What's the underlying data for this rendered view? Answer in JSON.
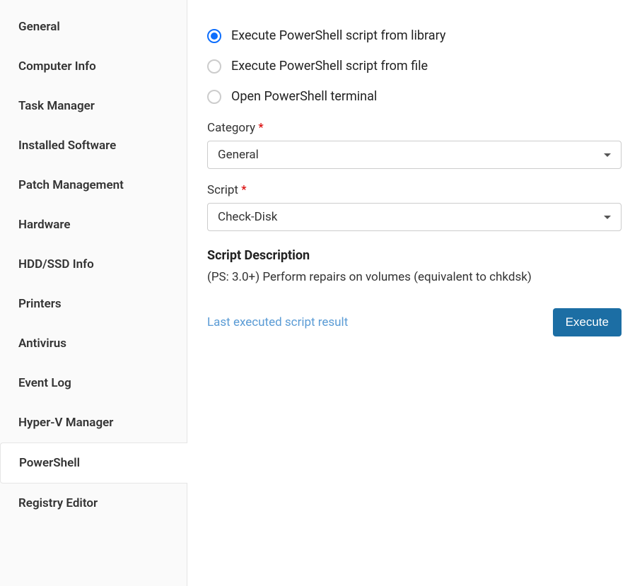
{
  "sidebar": {
    "items": [
      {
        "label": "General"
      },
      {
        "label": "Computer Info"
      },
      {
        "label": "Task Manager"
      },
      {
        "label": "Installed Software"
      },
      {
        "label": "Patch Management"
      },
      {
        "label": "Hardware"
      },
      {
        "label": "HDD/SSD Info"
      },
      {
        "label": "Printers"
      },
      {
        "label": "Antivirus"
      },
      {
        "label": "Event Log"
      },
      {
        "label": "Hyper-V Manager"
      },
      {
        "label": "PowerShell"
      },
      {
        "label": "Registry Editor"
      }
    ]
  },
  "main": {
    "radios": {
      "option1": "Execute PowerShell script from library",
      "option2": "Execute PowerShell script from file",
      "option3": "Open PowerShell terminal"
    },
    "category": {
      "label": "Category",
      "required": "*",
      "value": "General"
    },
    "script": {
      "label": "Script",
      "required": "*",
      "value": "Check-Disk"
    },
    "description": {
      "title": "Script Description",
      "text": "(PS: 3.0+) Perform repairs on volumes (equivalent to chkdsk)"
    },
    "footer": {
      "link": "Last executed script result",
      "button": "Execute"
    }
  }
}
